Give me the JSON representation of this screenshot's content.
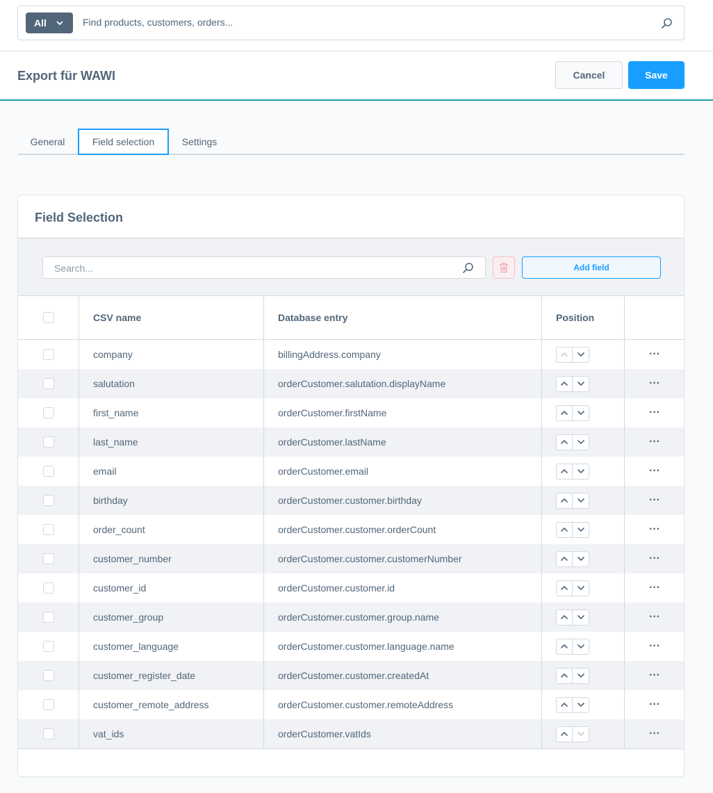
{
  "global_search": {
    "type_label": "All",
    "placeholder": "Find products, customers, orders..."
  },
  "header": {
    "title": "Export für WAWI",
    "cancel_label": "Cancel",
    "save_label": "Save"
  },
  "tabs": [
    {
      "label": "General"
    },
    {
      "label": "Field selection"
    },
    {
      "label": "Settings"
    }
  ],
  "card": {
    "title": "Field Selection",
    "search_placeholder": "Search...",
    "add_field_label": "Add field"
  },
  "table": {
    "columns": {
      "csv_name": "CSV name",
      "database_entry": "Database entry",
      "position": "Position"
    },
    "rows": [
      {
        "csv_name": "company",
        "database_entry": "billingAddress.company"
      },
      {
        "csv_name": "salutation",
        "database_entry": "orderCustomer.salutation.displayName"
      },
      {
        "csv_name": "first_name",
        "database_entry": "orderCustomer.firstName"
      },
      {
        "csv_name": "last_name",
        "database_entry": "orderCustomer.lastName"
      },
      {
        "csv_name": "email",
        "database_entry": "orderCustomer.email"
      },
      {
        "csv_name": "birthday",
        "database_entry": "orderCustomer.customer.birthday"
      },
      {
        "csv_name": "order_count",
        "database_entry": "orderCustomer.customer.orderCount"
      },
      {
        "csv_name": "customer_number",
        "database_entry": "orderCustomer.customer.customerNumber"
      },
      {
        "csv_name": "customer_id",
        "database_entry": "orderCustomer.customer.id"
      },
      {
        "csv_name": "customer_group",
        "database_entry": "orderCustomer.customer.group.name"
      },
      {
        "csv_name": "customer_language",
        "database_entry": "orderCustomer.customer.language.name"
      },
      {
        "csv_name": "customer_register_date",
        "database_entry": "orderCustomer.customer.createdAt"
      },
      {
        "csv_name": "customer_remote_address",
        "database_entry": "orderCustomer.customer.remoteAddress"
      },
      {
        "csv_name": "vat_ids",
        "database_entry": "orderCustomer.vatIds"
      }
    ],
    "row_action_label": "···"
  },
  "colors": {
    "primary": "#189eff",
    "text": "#52667a",
    "header_accent": "#189eaa"
  }
}
